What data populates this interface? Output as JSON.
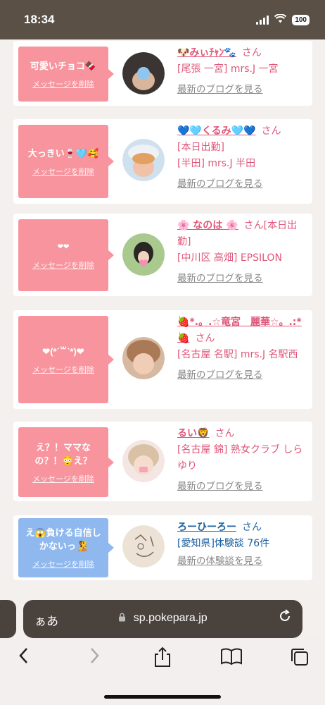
{
  "status": {
    "time": "18:34",
    "battery": "100"
  },
  "cards": [
    {
      "message": "可愛いチョコ🍫",
      "delete_label": "メッセージを削除",
      "bubble_color": "#f7949d",
      "name": "🐶みぃﾁｬﾝ🐾",
      "san": "さん",
      "lines": [
        "[尾張 一宮] mrs.J 一宮"
      ],
      "link": "最新のブログを見る",
      "avatar": "avatar-photo"
    },
    {
      "message": "大っきい🍷🩵🥰",
      "delete_label": "メッセージを削除",
      "bubble_color": "#f7949d",
      "name": "💙🩵くるみ🩵💙",
      "san": "さん",
      "lines": [
        "[本日出勤]",
        "[半田] mrs.J 半田"
      ],
      "link": "最新のブログを見る",
      "avatar": "avatar-photo"
    },
    {
      "message": "❤❤",
      "delete_label": "メッセージを削除",
      "bubble_color": "#f7949d",
      "name": "🌸 なのは 🌸",
      "san": "さん[本日出勤]",
      "lines": [
        "[中川区 高畑] EPSILON"
      ],
      "link": "最新のブログを見る",
      "avatar": "avatar-photo"
    },
    {
      "message": "❤(*´꒳`*)❤",
      "delete_label": "メッセージを削除",
      "bubble_color": "#f7949d",
      "name": "🍓*.。.☆竜宮　麗華☆。.:*🍓",
      "san": "さん",
      "lines": [
        "[名古屋 名駅] mrs.J 名駅西"
      ],
      "link": "最新のブログを見る",
      "avatar": "avatar-photo"
    },
    {
      "message": "え？！ママなの？！😳え？",
      "delete_label": "メッセージを削除",
      "bubble_color": "#f7949d",
      "name": "るい🦁",
      "san": "さん",
      "lines": [
        "[名古屋 錦] 熟女クラブ しらゆり"
      ],
      "link": "最新のブログを見る",
      "avatar": "avatar-photo"
    },
    {
      "message": "え😱負ける自信しかないっ🧏",
      "delete_label": "メッセージを削除",
      "bubble_color": "#8fb8ef",
      "name": "ろーひーろー",
      "san": "さん",
      "lines": [
        "[愛知県]体験談 76件"
      ],
      "link": "最新の体験談を見る",
      "avatar": "avatar-drawing"
    }
  ],
  "browser": {
    "text_size": "ぁあ",
    "url": "sp.pokepara.jp",
    "lock_icon": "lock-icon",
    "reload_icon": "reload-icon"
  },
  "toolbar": {
    "back_icon": "back-icon",
    "forward_icon": "forward-icon",
    "share_icon": "share-icon",
    "bookmarks_icon": "book-icon",
    "tabs_icon": "tabs-icon"
  }
}
